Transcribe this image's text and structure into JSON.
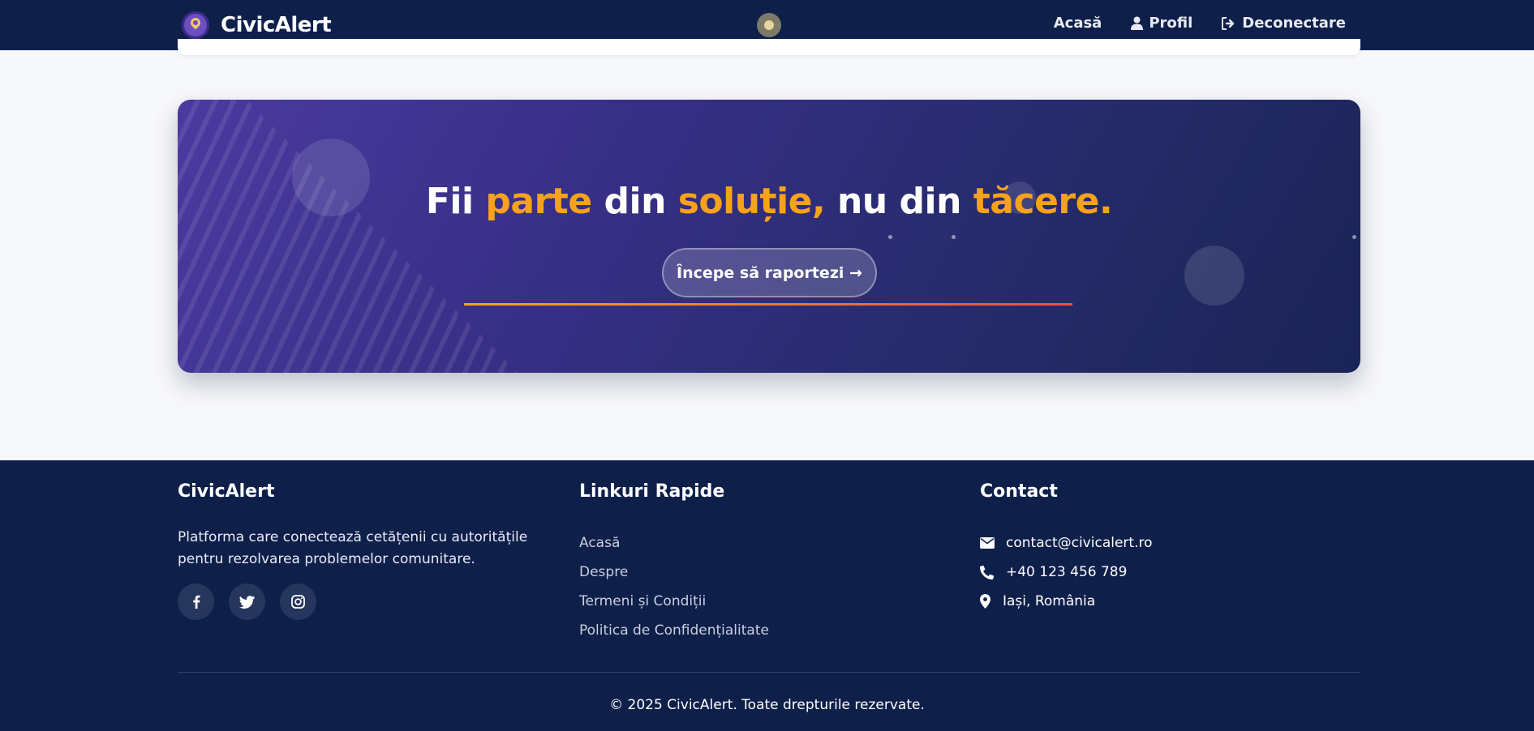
{
  "header": {
    "brand_name": "CivicAlert",
    "nav": [
      {
        "label": "Acasă",
        "icon": null
      },
      {
        "label": "Profil",
        "icon": "user-icon"
      },
      {
        "label": "Deconectare",
        "icon": "sign-out-icon"
      }
    ]
  },
  "cta": {
    "title_parts": [
      "Fii",
      "parte",
      "din",
      "soluție,",
      "nu",
      "din",
      "tăcere."
    ],
    "highlight_color": "#f7a21b",
    "button_label": "Începe să raportezi →"
  },
  "footer": {
    "about": {
      "title": "CivicAlert",
      "text": "Platforma care conectează cetățenii cu autoritățile pentru rezolvarea problemelor comunitare.",
      "socials": [
        "facebook-icon",
        "twitter-icon",
        "instagram-icon"
      ]
    },
    "quick_links": {
      "title": "Linkuri Rapide",
      "items": [
        "Acasă",
        "Despre",
        "Termeni și Condiții",
        "Politica de Confidențialitate"
      ]
    },
    "contact": {
      "title": "Contact",
      "email": "contact@civicalert.ro",
      "phone": "+40 123 456 789",
      "location": "Iași, România"
    },
    "copyright": "© 2025 CivicAlert. Toate drepturile rezervate."
  },
  "colors": {
    "navy": "#0e1f4a",
    "accent_orange": "#f7a21b",
    "accent_red": "#ef4b45",
    "background": "#f7f8fa"
  }
}
